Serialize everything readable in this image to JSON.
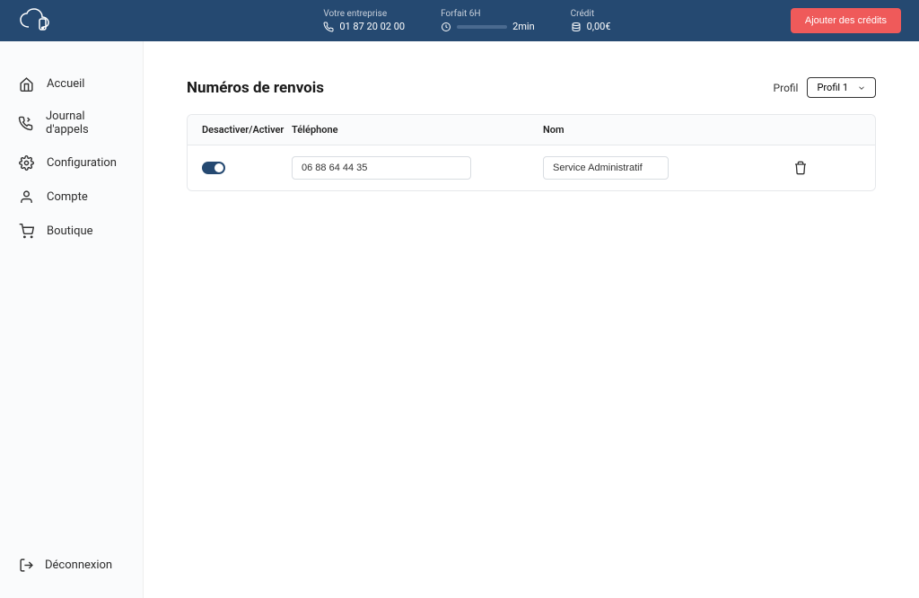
{
  "header": {
    "company_label": "Votre entreprise",
    "company_phone": "01 87 20 02 00",
    "plan_label": "Forfait 6H",
    "plan_remaining": "2min",
    "credit_label": "Crédit",
    "credit_value": "0,00€",
    "add_credits_label": "Ajouter des crédits"
  },
  "sidebar": {
    "items": [
      {
        "label": "Accueil"
      },
      {
        "label": "Journal d'appels"
      },
      {
        "label": "Configuration"
      },
      {
        "label": "Compte"
      },
      {
        "label": "Boutique"
      }
    ],
    "logout_label": "Déconnexion"
  },
  "page": {
    "title": "Numéros de renvois",
    "profile_label": "Profil",
    "profile_selected": "Profil 1"
  },
  "table": {
    "columns": {
      "toggle": "Desactiver/Activer",
      "phone": "Téléphone",
      "name": "Nom"
    },
    "rows": [
      {
        "active": true,
        "phone": "06 88 64 44 35",
        "name": "Service Administratif"
      }
    ]
  }
}
